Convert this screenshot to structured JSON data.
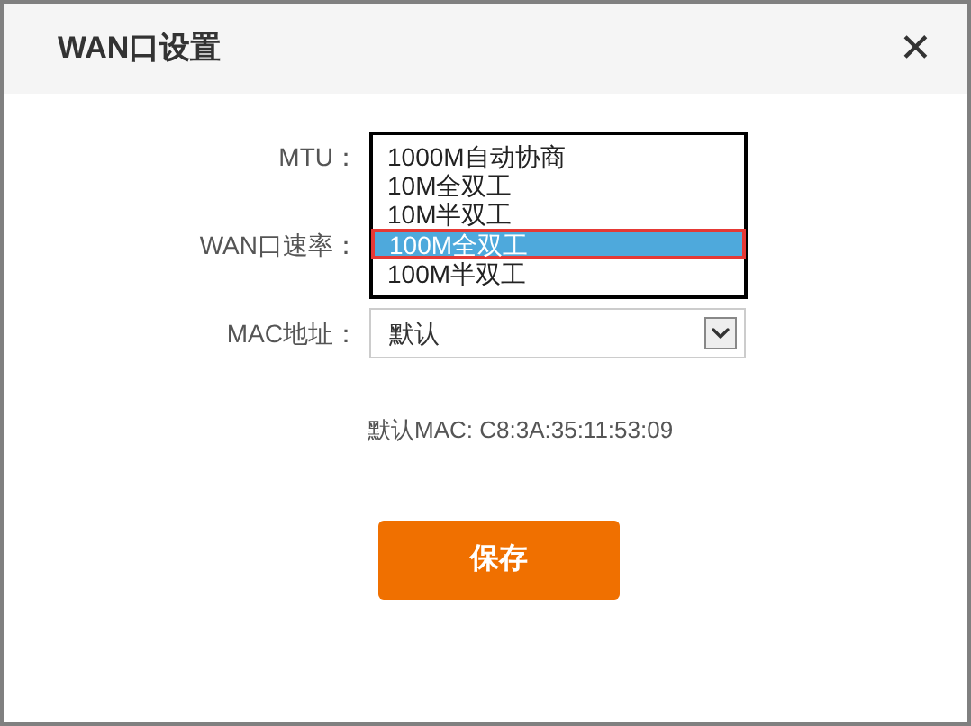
{
  "dialog": {
    "title": "WAN口设置",
    "close": "✕"
  },
  "fields": [
    {
      "label": "MTU："
    },
    {
      "label": "WAN口速率："
    },
    {
      "label": "MAC地址：",
      "value": "默认"
    }
  ],
  "dropdown_options": [
    {
      "label": "1000M自动协商",
      "selected": false
    },
    {
      "label": "10M全双工",
      "selected": false
    },
    {
      "label": "10M半双工",
      "selected": false
    },
    {
      "label": "100M全双工",
      "selected": true
    },
    {
      "label": "100M半双工",
      "selected": false
    }
  ],
  "default_mac": "默认MAC: C8:3A:35:11:53:09",
  "save_button": "保存"
}
